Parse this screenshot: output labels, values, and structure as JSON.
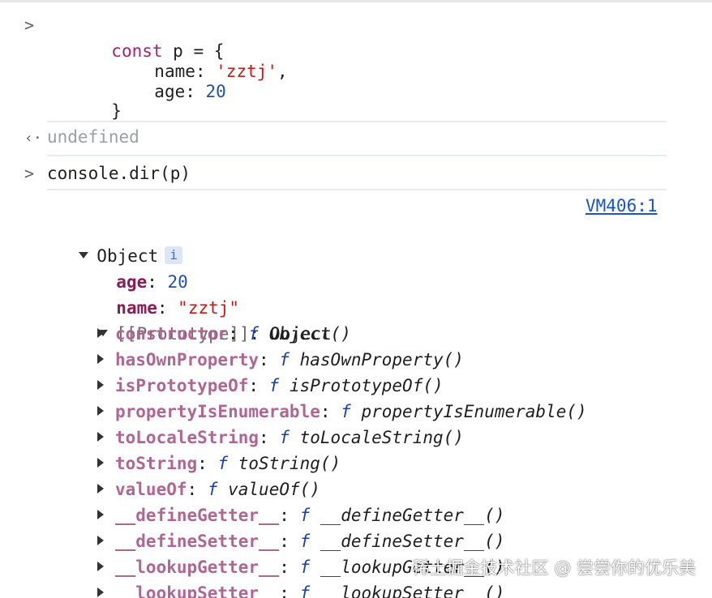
{
  "input1": {
    "code_line1": {
      "kw": "const",
      "rest": " p = {"
    },
    "code_line2": {
      "key": "name: ",
      "val": "'zztj'",
      "tail": ","
    },
    "code_line3": {
      "key": "age: ",
      "val": "20"
    },
    "code_line4": "}"
  },
  "output1": "undefined",
  "input2": "console.dir(p)",
  "source_link": "VM406:1",
  "object": {
    "label": "Object",
    "info_badge": "i",
    "props": [
      {
        "key": "age",
        "sep": ": ",
        "value": "20",
        "kind": "number"
      },
      {
        "key": "name",
        "sep": ": ",
        "value": "\"zztj\"",
        "kind": "string"
      }
    ],
    "prototype_label": "[[Prototype]]",
    "prototype_value": ": Object",
    "proto_members": [
      {
        "key": "constructor",
        "fn": "Object()"
      },
      {
        "key": "hasOwnProperty",
        "fn": "hasOwnProperty()"
      },
      {
        "key": "isPrototypeOf",
        "fn": "isPrototypeOf()"
      },
      {
        "key": "propertyIsEnumerable",
        "fn": "propertyIsEnumerable()"
      },
      {
        "key": "toLocaleString",
        "fn": "toLocaleString()"
      },
      {
        "key": "toString",
        "fn": "toString()"
      },
      {
        "key": "valueOf",
        "fn": "valueOf()"
      },
      {
        "key": "__defineGetter__",
        "fn": "__defineGetter__()"
      },
      {
        "key": "__defineSetter__",
        "fn": "__defineSetter__()"
      },
      {
        "key": "__lookupGetter__",
        "fn": "__lookupGetter__()"
      },
      {
        "key": "__lookupSetter__",
        "fn": "__lookupSetter__()"
      }
    ],
    "f_symbol": "f",
    "colon": ": "
  },
  "watermark": "稀土掘金技术社区 @ 尝尝你的优乐美",
  "icons": {
    "input_prompt": "chevron-right-icon",
    "output_prompt": "return-arrow-icon",
    "expand": "triangle-down-icon",
    "collapsed": "triangle-right-icon"
  }
}
